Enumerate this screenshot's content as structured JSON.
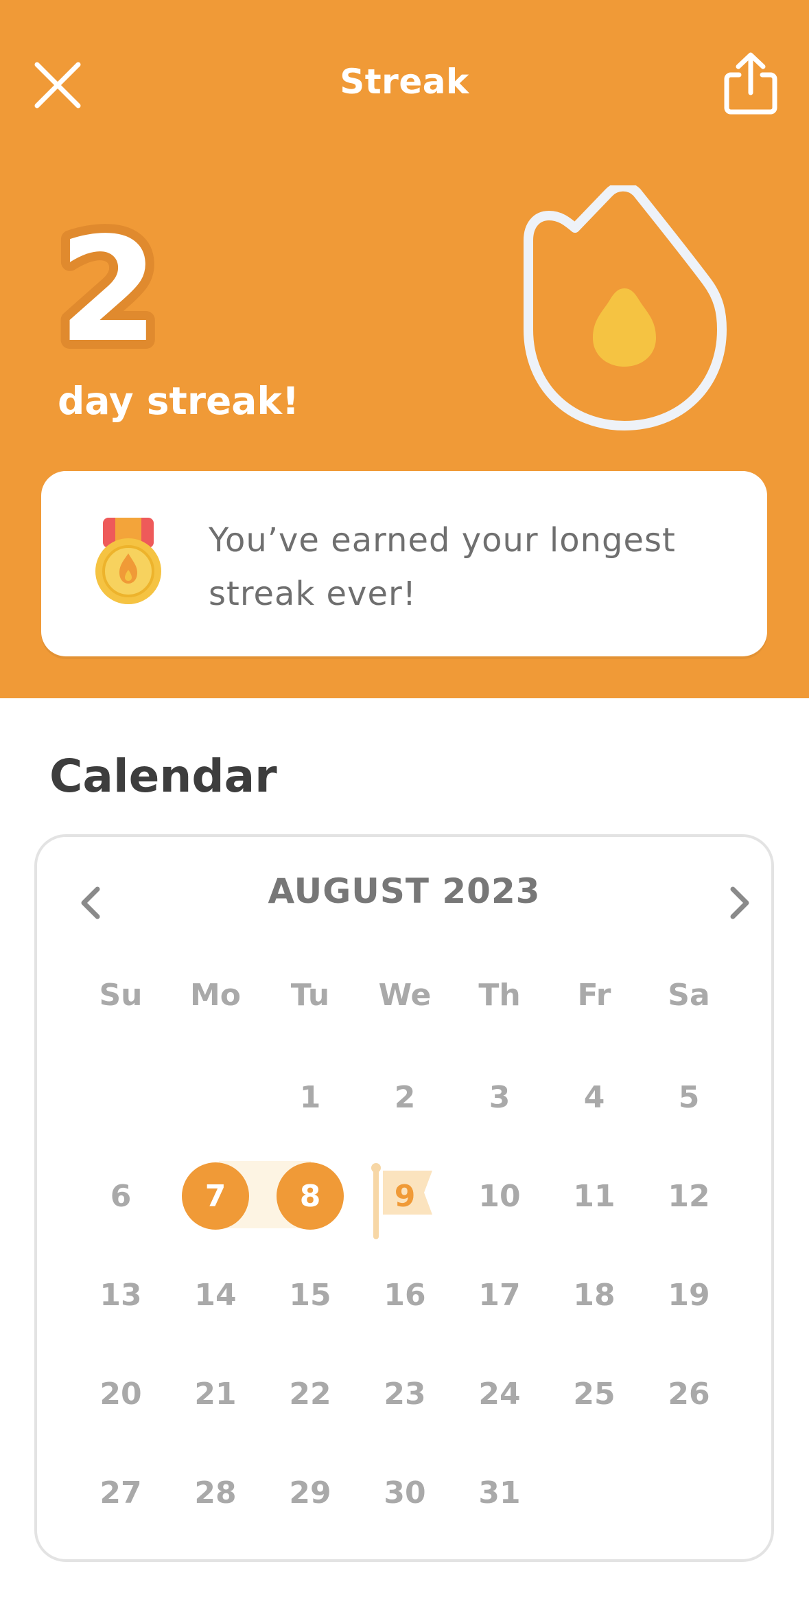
{
  "header": {
    "title": "Streak",
    "close_icon": "close-icon",
    "share_icon": "share-icon",
    "background": "#F09A37"
  },
  "streak": {
    "count": "2",
    "label": "day streak!"
  },
  "banner": {
    "text": "You’ve earned your longest streak ever!",
    "icon": "medal-icon"
  },
  "calendar": {
    "heading": "Calendar",
    "month": "AUGUST 2023",
    "prev_icon": "chevron-left-icon",
    "next_icon": "chevron-right-icon",
    "weekdays": [
      "Su",
      "Mo",
      "Tu",
      "We",
      "Th",
      "Fr",
      "Sa"
    ],
    "first_weekday_index": 2,
    "days_in_month": 31,
    "streak_days": [
      7,
      8
    ],
    "today": 9,
    "accent": "#F09A37"
  }
}
